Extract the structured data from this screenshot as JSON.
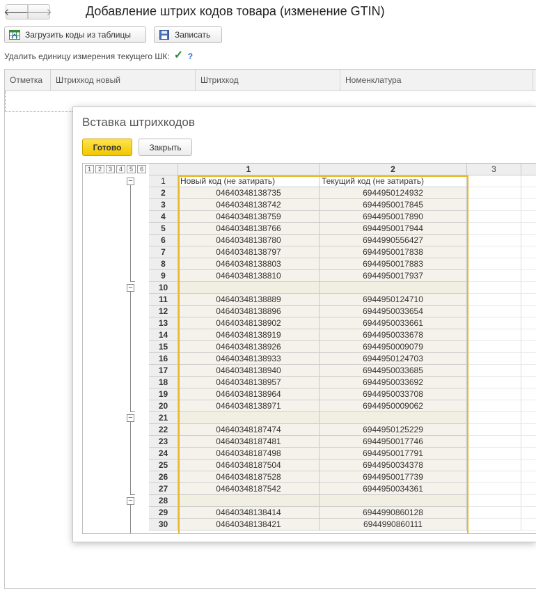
{
  "window": {
    "title": "Добавление штрих кодов товара (изменение GTIN)",
    "back_icon": "arrow-left-icon",
    "forward_icon": "arrow-right-icon"
  },
  "toolbar": {
    "load_label": "Загрузить коды из таблицы",
    "save_label": "Записать"
  },
  "options": {
    "delete_unit_label": "Удалить единицу измерения текущего ШК:",
    "delete_unit_checked": true,
    "help": "?"
  },
  "main_grid": {
    "columns": [
      "Отметка",
      "Штрихкод новый",
      "Штрихкод",
      "Номенклатура"
    ]
  },
  "dialog": {
    "title": "Вставка штрихкодов",
    "done_label": "Готово",
    "close_label": "Закрыть",
    "sheet": {
      "levels": [
        "1",
        "2",
        "3",
        "4",
        "5",
        "6"
      ],
      "column_headers": [
        "1",
        "2",
        "3"
      ],
      "header_row": {
        "num": "1",
        "col1": "Новый код (не затирать)",
        "col2": "Текущий код (не затирать)"
      },
      "rows": [
        {
          "num": "2",
          "col1": "04640348138735",
          "col2": "6944950124932"
        },
        {
          "num": "3",
          "col1": "04640348138742",
          "col2": "6944950017845"
        },
        {
          "num": "4",
          "col1": "04640348138759",
          "col2": "6944950017890"
        },
        {
          "num": "5",
          "col1": "04640348138766",
          "col2": "6944950017944"
        },
        {
          "num": "6",
          "col1": "04640348138780",
          "col2": "6944990556427"
        },
        {
          "num": "7",
          "col1": "04640348138797",
          "col2": "6944950017838"
        },
        {
          "num": "8",
          "col1": "04640348138803",
          "col2": "6944950017883"
        },
        {
          "num": "9",
          "col1": "04640348138810",
          "col2": "6944950017937"
        },
        {
          "num": "10",
          "col1": "",
          "col2": ""
        },
        {
          "num": "11",
          "col1": "04640348138889",
          "col2": "6944950124710"
        },
        {
          "num": "12",
          "col1": "04640348138896",
          "col2": "6944950033654"
        },
        {
          "num": "13",
          "col1": "04640348138902",
          "col2": "6944950033661"
        },
        {
          "num": "14",
          "col1": "04640348138919",
          "col2": "6944950033678"
        },
        {
          "num": "15",
          "col1": "04640348138926",
          "col2": "6944950009079"
        },
        {
          "num": "16",
          "col1": "04640348138933",
          "col2": "6944950124703"
        },
        {
          "num": "17",
          "col1": "04640348138940",
          "col2": "6944950033685"
        },
        {
          "num": "18",
          "col1": "04640348138957",
          "col2": "6944950033692"
        },
        {
          "num": "19",
          "col1": "04640348138964",
          "col2": "6944950033708"
        },
        {
          "num": "20",
          "col1": "04640348138971",
          "col2": "6944950009062"
        },
        {
          "num": "21",
          "col1": "",
          "col2": ""
        },
        {
          "num": "22",
          "col1": "04640348187474",
          "col2": "6944950125229"
        },
        {
          "num": "23",
          "col1": "04640348187481",
          "col2": "6944950017746"
        },
        {
          "num": "24",
          "col1": "04640348187498",
          "col2": "6944950017791"
        },
        {
          "num": "25",
          "col1": "04640348187504",
          "col2": "6944950034378"
        },
        {
          "num": "26",
          "col1": "04640348187528",
          "col2": "6944950017739"
        },
        {
          "num": "27",
          "col1": "04640348187542",
          "col2": "6944950034361"
        },
        {
          "num": "28",
          "col1": "",
          "col2": ""
        },
        {
          "num": "29",
          "col1": "04640348138414",
          "col2": "6944990860128"
        },
        {
          "num": "30",
          "col1": "04640348138421",
          "col2": "6944990860111"
        }
      ]
    }
  },
  "colors": {
    "accent_yellow": "#f2c800",
    "selection_border": "#e8b92a",
    "check_green": "#2b8a3e",
    "help_blue": "#2a6bc9"
  }
}
